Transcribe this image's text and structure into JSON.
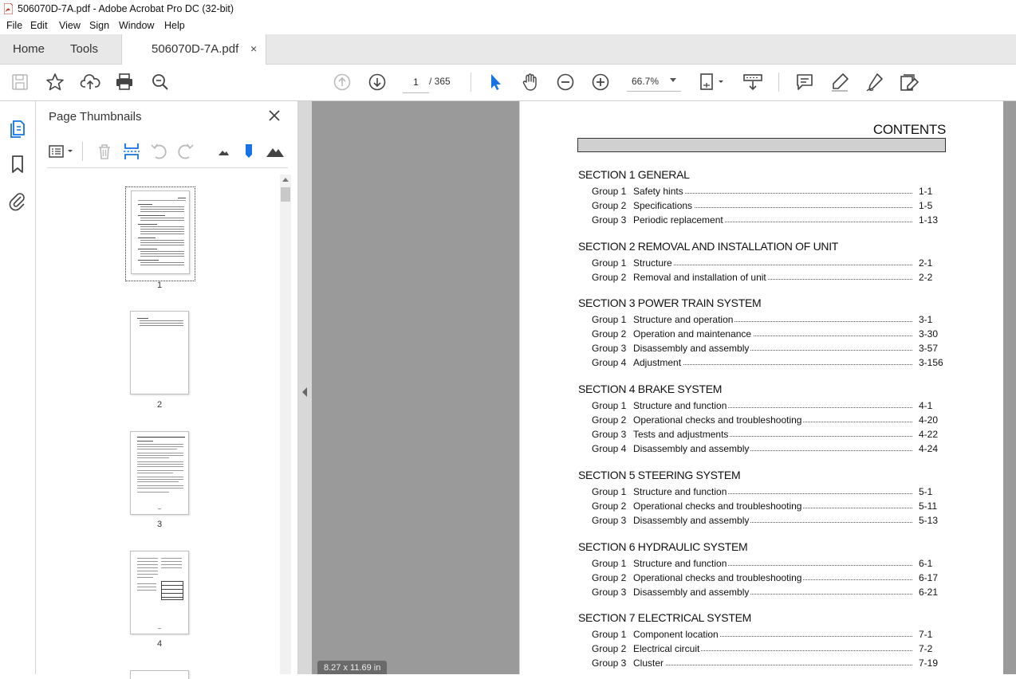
{
  "window": {
    "title": "506070D-7A.pdf - Adobe Acrobat Pro DC (32-bit)"
  },
  "menu": [
    "File",
    "Edit",
    "View",
    "Sign",
    "Window",
    "Help"
  ],
  "tabs": {
    "home": "Home",
    "tools": "Tools",
    "doc": "506070D-7A.pdf",
    "close": "×"
  },
  "toolbar": {
    "page_current": "1",
    "page_total": "/  365",
    "zoom": "66.7%"
  },
  "icons": [
    "save-icon",
    "star-icon",
    "upload-icon",
    "print-icon",
    "search-zoom-icon",
    "prev-page-icon",
    "next-page-icon",
    "select-cursor-icon",
    "hand-icon",
    "zoom-out-icon",
    "zoom-in-icon",
    "fit-page-icon",
    "scroll-mode-icon",
    "comment-icon",
    "highlight-icon",
    "fill-sign-icon",
    "edit-pdf-icon"
  ],
  "colors": {
    "accent": "#1473e6",
    "tabbar": "#e8e8e8",
    "doc_gray": "#9a9a9a"
  },
  "panel": {
    "title": "Page Thumbnails",
    "thumbnails": [
      {
        "label": "1"
      },
      {
        "label": "2"
      },
      {
        "label": "3"
      },
      {
        "label": "4"
      }
    ]
  },
  "doc": {
    "page_size": "8.27 x 11.69 in",
    "contents_title": "CONTENTS",
    "sections": [
      {
        "title": "SECTION 1  GENERAL",
        "groups": [
          {
            "group": "Group   1",
            "title": "Safety hints",
            "page": "1-1"
          },
          {
            "group": "Group   2",
            "title": "Specifications",
            "page": "1-5"
          },
          {
            "group": "Group   3",
            "title": "Periodic replacement",
            "page": "1-13"
          }
        ]
      },
      {
        "title": "SECTION 2  REMOVAL AND INSTALLATION OF UNIT",
        "groups": [
          {
            "group": "Group   1",
            "title": "Structure",
            "page": "2-1"
          },
          {
            "group": "Group   2",
            "title": "Removal and installation of unit",
            "page": "2-2"
          }
        ]
      },
      {
        "title": "SECTION 3  POWER TRAIN SYSTEM",
        "groups": [
          {
            "group": "Group   1",
            "title": "Structure and operation",
            "page": "3-1"
          },
          {
            "group": "Group   2",
            "title": "Operation and maintenance",
            "page": "3-30"
          },
          {
            "group": "Group   3",
            "title": "Disassembly and assembly",
            "page": "3-57"
          },
          {
            "group": "Group   4",
            "title": "Adjustment",
            "page": "3-156"
          }
        ]
      },
      {
        "title": "SECTION 4  BRAKE SYSTEM",
        "groups": [
          {
            "group": "Group   1",
            "title": "Structure and function",
            "page": "4-1"
          },
          {
            "group": "Group   2",
            "title": "Operational checks and troubleshooting",
            "page": "4-20"
          },
          {
            "group": "Group   3",
            "title": "Tests and adjustments",
            "page": "4-22"
          },
          {
            "group": "Group   4",
            "title": "Disassembly and assembly",
            "page": "4-24"
          }
        ]
      },
      {
        "title": "SECTION 5  STEERING SYSTEM",
        "groups": [
          {
            "group": "Group   1",
            "title": "Structure and function",
            "page": "5-1"
          },
          {
            "group": "Group   2",
            "title": "Operational checks and troubleshooting",
            "page": "5-11"
          },
          {
            "group": "Group   3",
            "title": "Disassembly and assembly",
            "page": "5-13"
          }
        ]
      },
      {
        "title": "SECTION 6  HYDRAULIC SYSTEM",
        "groups": [
          {
            "group": "Group   1",
            "title": "Structure and function",
            "page": "6-1"
          },
          {
            "group": "Group   2",
            "title": "Operational checks and troubleshooting",
            "page": "6-17"
          },
          {
            "group": "Group   3",
            "title": "Disassembly and assembly",
            "page": "6-21"
          }
        ]
      },
      {
        "title": "SECTION 7  ELECTRICAL SYSTEM",
        "groups": [
          {
            "group": "Group   1",
            "title": "Component location",
            "page": "7-1"
          },
          {
            "group": "Group   2",
            "title": "Electrical circuit",
            "page": "7-2"
          },
          {
            "group": "Group   3",
            "title": "Cluster",
            "page": "7-19"
          }
        ]
      }
    ]
  }
}
